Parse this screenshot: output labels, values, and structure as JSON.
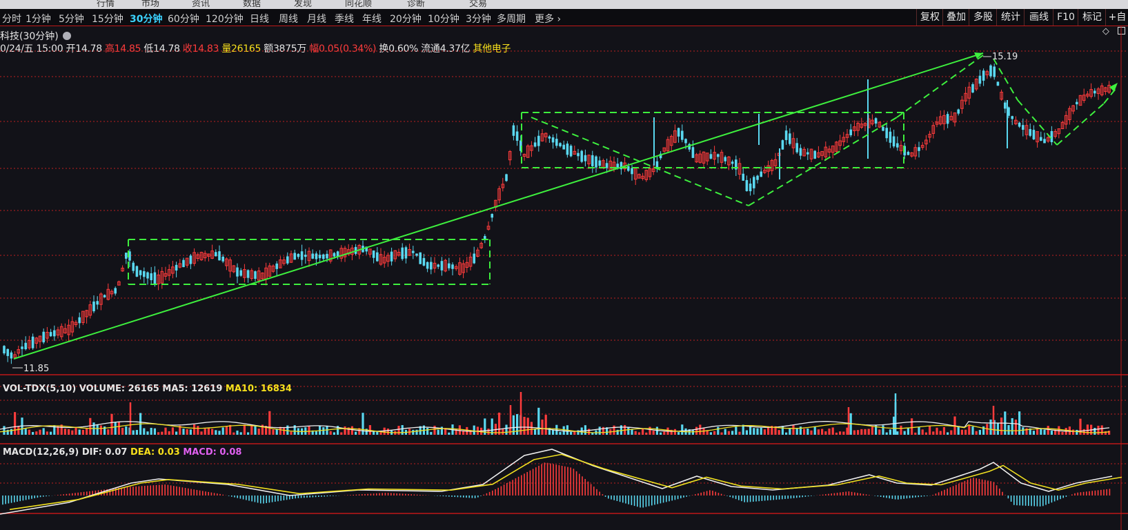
{
  "periods": [
    "分时",
    "1分钟",
    "5分钟",
    "15分钟",
    "30分钟",
    "60分钟",
    "120分钟",
    "日线",
    "周线",
    "月线",
    "季线",
    "年线",
    "20分钟",
    "10分钟",
    "3分钟",
    "多周期",
    "更多 ›"
  ],
  "active_period": "30分钟",
  "top_menu_partial": [
    "行情",
    "市场",
    "资讯",
    "数据",
    "发现",
    "同花顺",
    "诊断",
    "交易"
  ],
  "tools": [
    "复权",
    "叠加",
    "多股",
    "统计",
    "画线",
    "F10",
    "标记",
    "+自"
  ],
  "header": {
    "stock_name": "科技(30分钟)",
    "date": "0/24/五 15:00",
    "open_label": "开",
    "open": "14.78",
    "high_label": "高",
    "high": "14.85",
    "low_label": "低",
    "low": "14.78",
    "close_label": "收",
    "close": "14.83",
    "vol_label": "量",
    "vol": "26165",
    "amount_label": "额",
    "amount": "3875万",
    "change_label": "幅",
    "change": "0.05(0.34%)",
    "turnover_label": "换",
    "turnover": "0.60%",
    "float_label": "流通",
    "float": "4.37亿",
    "sector": "其他电子"
  },
  "volume_header": {
    "name": "VOL-TDX(5,10)",
    "volume": "VOLUME: 26165",
    "ma5": "MA5: 12619",
    "ma10": "MA10: 16834"
  },
  "macd_header": {
    "name": "MACD(12,26,9)",
    "dif": "DIF: 0.07",
    "dea": "DEA: 0.03",
    "macd": "MACD: 0.08"
  },
  "price_labels": {
    "high": "15.19",
    "low": "11.85"
  },
  "chart_data": {
    "type": "candlestick",
    "period": "30分钟",
    "y_high": 15.19,
    "y_low": 11.85,
    "last": {
      "open": 14.78,
      "high": 14.85,
      "low": 14.78,
      "close": 14.83,
      "volume": 26165
    },
    "volume_ma5": 12619,
    "volume_ma10": 16834,
    "macd": {
      "dif": 0.07,
      "dea": 0.03,
      "macd": 0.08
    }
  },
  "colors": {
    "up": "#ff3c3c",
    "down": "#5ad8f0",
    "annotation": "#3ef03e",
    "grid": "#c02020",
    "ma_white": "#f0f0f0",
    "ma_yellow": "#f0e020"
  }
}
